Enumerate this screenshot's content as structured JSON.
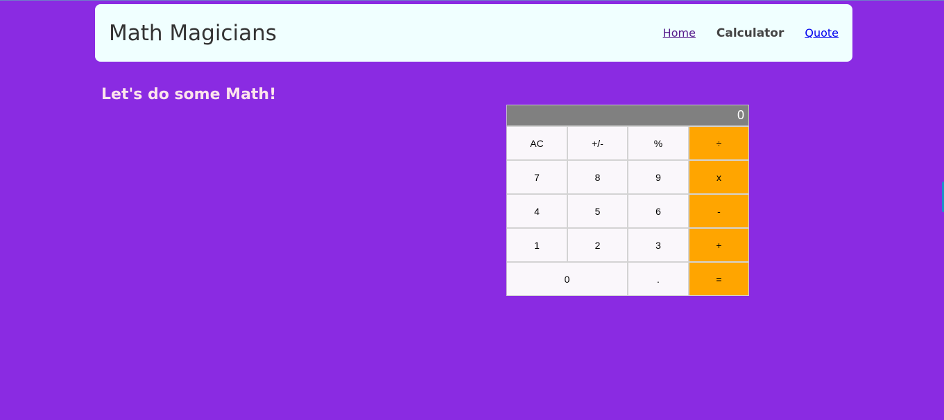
{
  "header": {
    "brand": "Math Magicians",
    "nav": {
      "home": "Home",
      "calculator": "Calculator",
      "quote": "Quote"
    }
  },
  "main": {
    "heading": "Let's do some Math!"
  },
  "calculator": {
    "display": "0",
    "keys": {
      "ac": "AC",
      "sign": "+/-",
      "percent": "%",
      "divide": "÷",
      "seven": "7",
      "eight": "8",
      "nine": "9",
      "multiply": "x",
      "four": "4",
      "five": "5",
      "six": "6",
      "minus": "-",
      "one": "1",
      "two": "2",
      "three": "3",
      "plus": "+",
      "zero": "0",
      "dot": ".",
      "equals": "="
    }
  },
  "colors": {
    "page_background": "#8a2be2",
    "header_background": "#f0ffff",
    "operator_key": "#ffa500",
    "display_background": "#808080",
    "heading_text": "#fde4ec"
  }
}
